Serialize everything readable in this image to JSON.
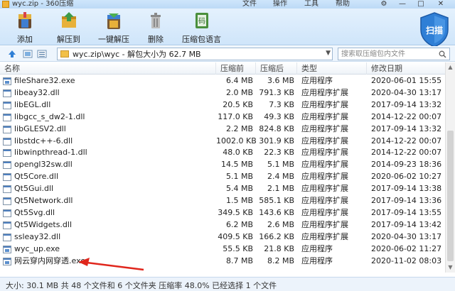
{
  "window": {
    "title": "wyc.zip - 360压缩",
    "menu": [
      "文件",
      "操作",
      "工具",
      "帮助"
    ],
    "controls": [
      "—",
      "□",
      "✕"
    ]
  },
  "toolbar": {
    "buttons": [
      {
        "label": "添加",
        "icon": "add-icon"
      },
      {
        "label": "解压到",
        "icon": "extract-to-icon"
      },
      {
        "label": "一键解压",
        "icon": "one-click-extract-icon"
      },
      {
        "label": "删除",
        "icon": "delete-icon"
      },
      {
        "label": "压缩包语言",
        "icon": "archive-language-icon"
      }
    ],
    "scan_label": "扫描"
  },
  "address": {
    "path": "wyc.zip\\wyc - 解包大小为 62.7 MB",
    "search_placeholder": "搜索取压缩包内文件"
  },
  "columns": {
    "name": "名称",
    "size": "压缩前",
    "packed": "压缩后",
    "type": "类型",
    "modified": "修改日期"
  },
  "files": [
    {
      "name": "fileShare32.exe",
      "size": "6.4 MB",
      "packed": "3.6 MB",
      "type": "应用程序",
      "modified": "2020-06-01 15:55",
      "kind": "exe"
    },
    {
      "name": "libeay32.dll",
      "size": "2.0 MB",
      "packed": "791.3 KB",
      "type": "应用程序扩展",
      "modified": "2020-04-30 13:17",
      "kind": "dll"
    },
    {
      "name": "libEGL.dll",
      "size": "20.5 KB",
      "packed": "7.3 KB",
      "type": "应用程序扩展",
      "modified": "2017-09-14 13:32",
      "kind": "dll"
    },
    {
      "name": "libgcc_s_dw2-1.dll",
      "size": "117.0 KB",
      "packed": "49.3 KB",
      "type": "应用程序扩展",
      "modified": "2014-12-22 00:07",
      "kind": "dll"
    },
    {
      "name": "libGLESV2.dll",
      "size": "2.2 MB",
      "packed": "824.8 KB",
      "type": "应用程序扩展",
      "modified": "2017-09-14 13:32",
      "kind": "dll"
    },
    {
      "name": "libstdc++-6.dll",
      "size": "1002.0 KB",
      "packed": "301.9 KB",
      "type": "应用程序扩展",
      "modified": "2014-12-22 00:07",
      "kind": "dll"
    },
    {
      "name": "libwinpthread-1.dll",
      "size": "48.0 KB",
      "packed": "22.3 KB",
      "type": "应用程序扩展",
      "modified": "2014-12-22 00:07",
      "kind": "dll"
    },
    {
      "name": "opengl32sw.dll",
      "size": "14.5 MB",
      "packed": "5.1 MB",
      "type": "应用程序扩展",
      "modified": "2014-09-23 18:36",
      "kind": "dll"
    },
    {
      "name": "Qt5Core.dll",
      "size": "5.1 MB",
      "packed": "2.4 MB",
      "type": "应用程序扩展",
      "modified": "2020-06-02 10:27",
      "kind": "dll"
    },
    {
      "name": "Qt5Gui.dll",
      "size": "5.4 MB",
      "packed": "2.1 MB",
      "type": "应用程序扩展",
      "modified": "2017-09-14 13:38",
      "kind": "dll"
    },
    {
      "name": "Qt5Network.dll",
      "size": "1.5 MB",
      "packed": "585.1 KB",
      "type": "应用程序扩展",
      "modified": "2017-09-14 13:36",
      "kind": "dll"
    },
    {
      "name": "Qt5Svg.dll",
      "size": "349.5 KB",
      "packed": "143.6 KB",
      "type": "应用程序扩展",
      "modified": "2017-09-14 13:55",
      "kind": "dll"
    },
    {
      "name": "Qt5Widgets.dll",
      "size": "6.2 MB",
      "packed": "2.6 MB",
      "type": "应用程序扩展",
      "modified": "2017-09-14 13:42",
      "kind": "dll"
    },
    {
      "name": "ssleay32.dll",
      "size": "409.5 KB",
      "packed": "166.2 KB",
      "type": "应用程序扩展",
      "modified": "2020-04-30 13:17",
      "kind": "dll"
    },
    {
      "name": "wyc_up.exe",
      "size": "55.5 KB",
      "packed": "21.8 KB",
      "type": "应用程序",
      "modified": "2020-06-02 11:27",
      "kind": "exe"
    },
    {
      "name": "网云穿内网穿透.exe",
      "size": "8.7 MB",
      "packed": "8.2 MB",
      "type": "应用程序",
      "modified": "2020-11-02 08:03",
      "kind": "exe"
    }
  ],
  "status": "大小: 30.1 MB 共 48 个文件和 6 个文件夹 压缩率 48.0% 已经选择 1 个文件",
  "colors": {
    "accent": "#2f7fd6",
    "annotation_arrow": "#e0261c"
  }
}
